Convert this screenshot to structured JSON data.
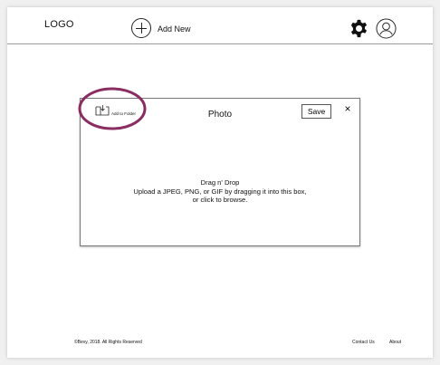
{
  "header": {
    "logo": "LOGO",
    "add_new_label": "Add New",
    "settings_icon": "gear-icon",
    "profile_icon": "avatar-icon"
  },
  "dialog": {
    "add_to_folder_label": "Add to Folder",
    "title": "Photo",
    "save_label": "Save",
    "close_label": "×",
    "drop_title": "Drag n' Drop",
    "drop_description": "Upload a JPEG, PNG, or GIF by dragging it into this box, or click to browse.",
    "highlight_color": "#8a2e62"
  },
  "footer": {
    "copyright": "©Bevy, 2018. All Rights Reserved",
    "contact_label": "Contact Us",
    "about_label": "About"
  }
}
